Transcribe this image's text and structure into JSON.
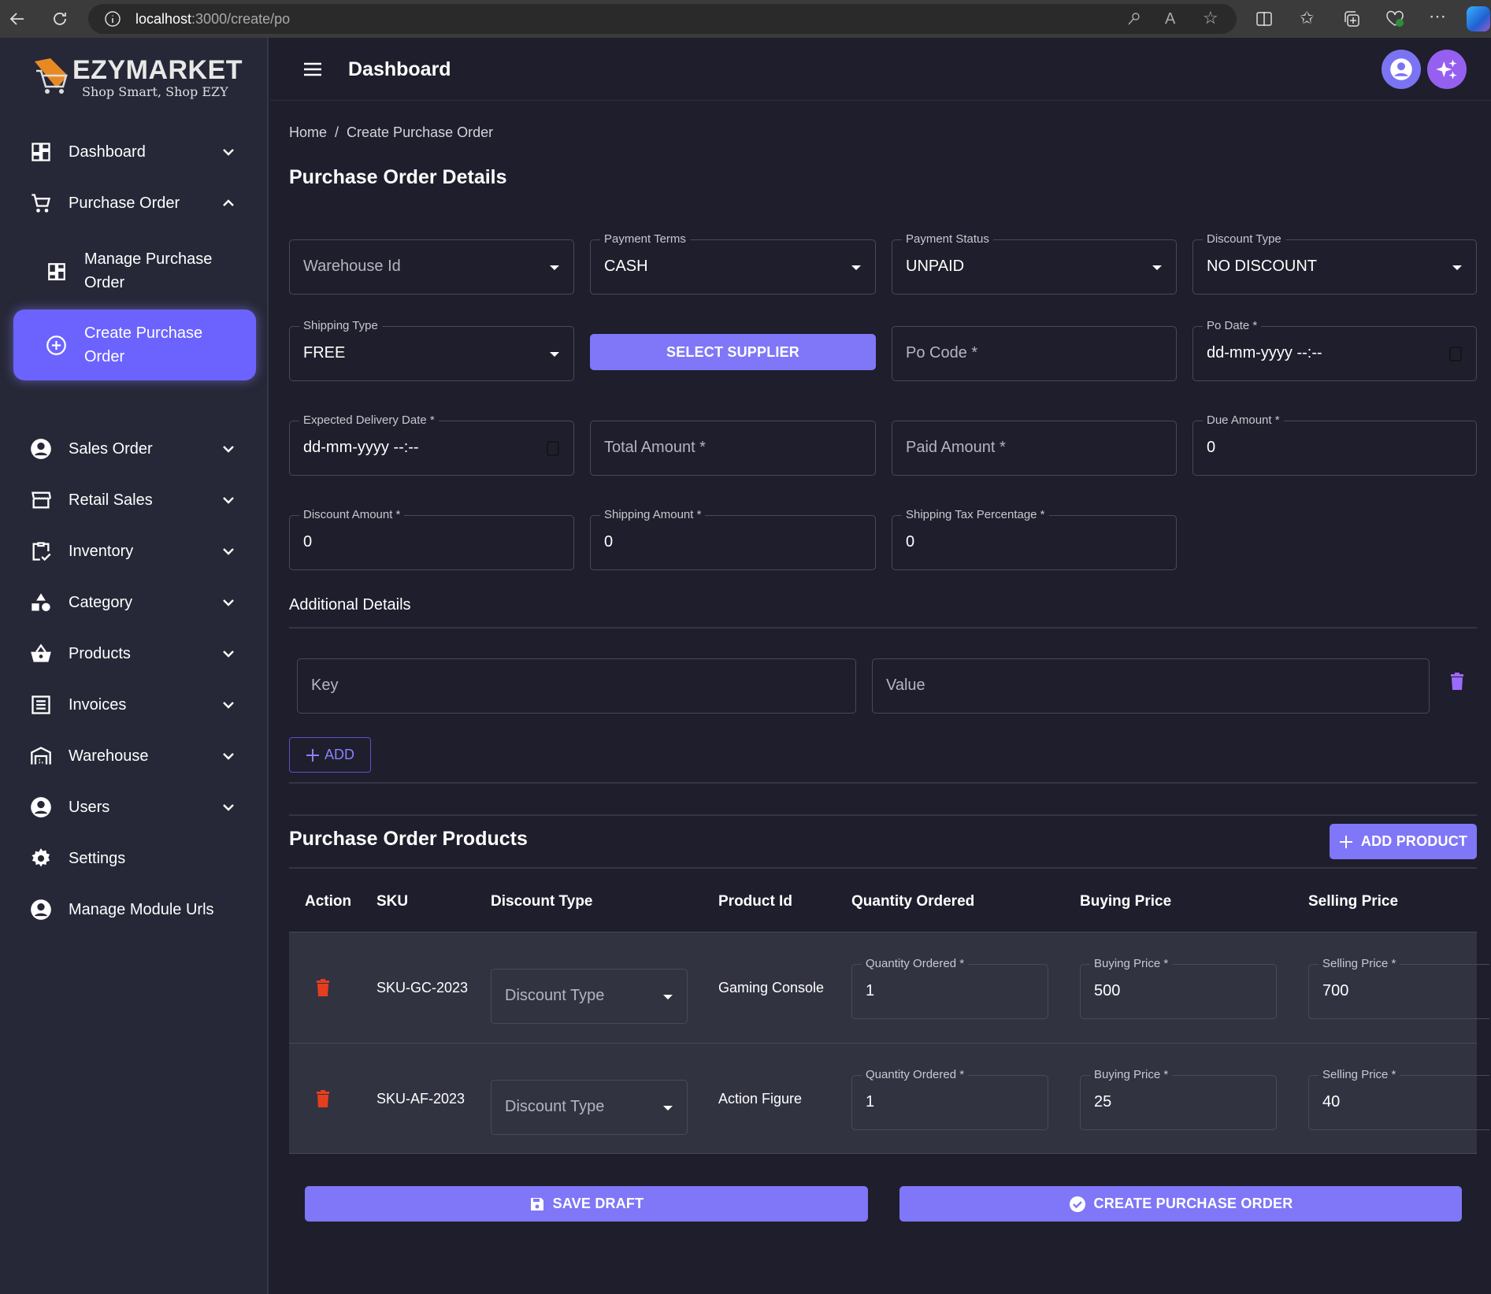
{
  "browser": {
    "url_host": "localhost",
    "url_path": ":3000/create/po"
  },
  "brand": {
    "name": "EZYMARKET",
    "tagline": "Shop Smart, Shop EZY"
  },
  "header": {
    "title": "Dashboard"
  },
  "sidebar": {
    "items": [
      {
        "label": "Dashboard",
        "icon": "dashboard-icon",
        "chevron": "down"
      },
      {
        "label": "Purchase Order",
        "icon": "cart-icon",
        "chevron": "up"
      },
      {
        "label": "Sales Order",
        "icon": "account-circle-icon",
        "chevron": "down"
      },
      {
        "label": "Retail Sales",
        "icon": "storefront-icon",
        "chevron": "down"
      },
      {
        "label": "Inventory",
        "icon": "clipboard-check-icon",
        "chevron": "down"
      },
      {
        "label": "Category",
        "icon": "category-shapes-icon",
        "chevron": "down"
      },
      {
        "label": "Products",
        "icon": "basket-icon",
        "chevron": "down"
      },
      {
        "label": "Invoices",
        "icon": "receipt-icon",
        "chevron": "down"
      },
      {
        "label": "Warehouse",
        "icon": "warehouse-icon",
        "chevron": "down"
      },
      {
        "label": "Users",
        "icon": "account-circle-icon",
        "chevron": "down"
      },
      {
        "label": "Settings",
        "icon": "gear-icon"
      },
      {
        "label": "Manage Module Urls",
        "icon": "account-circle-icon"
      }
    ],
    "sub_items": [
      {
        "label_line1": "Manage Purchase",
        "label_line2": "Order",
        "icon": "dashboard-icon"
      },
      {
        "label_line1": "Create Purchase",
        "label_line2": "Order",
        "icon": "add-circle-icon",
        "active": true
      }
    ]
  },
  "breadcrumb": {
    "home": "Home",
    "separator": "/",
    "current": "Create Purchase Order"
  },
  "details": {
    "title": "Purchase Order Details",
    "warehouse_id": {
      "placeholder": "Warehouse Id"
    },
    "payment_terms": {
      "label": "Payment Terms",
      "value": "CASH"
    },
    "payment_status": {
      "label": "Payment Status",
      "value": "UNPAID"
    },
    "discount_type": {
      "label": "Discount Type",
      "value": "NO DISCOUNT"
    },
    "shipping_type": {
      "label": "Shipping Type",
      "value": "FREE"
    },
    "select_supplier": "SELECT SUPPLIER",
    "po_code": {
      "placeholder": "Po Code *"
    },
    "po_date": {
      "label": "Po Date *",
      "value": "dd-mm-yyyy --:--"
    },
    "expected_delivery_date": {
      "label": "Expected Delivery Date *",
      "value": "dd-mm-yyyy --:--"
    },
    "total_amount": {
      "placeholder": "Total Amount *"
    },
    "paid_amount": {
      "placeholder": "Paid Amount *"
    },
    "due_amount": {
      "label": "Due Amount *",
      "value": "0"
    },
    "discount_amount": {
      "label": "Discount Amount *",
      "value": "0"
    },
    "shipping_amount": {
      "label": "Shipping Amount *",
      "value": "0"
    },
    "shipping_tax_percentage": {
      "label": "Shipping Tax Percentage *",
      "value": "0"
    }
  },
  "additional": {
    "title": "Additional Details",
    "key_placeholder": "Key",
    "value_placeholder": "Value",
    "add_label": "ADD"
  },
  "products": {
    "title": "Purchase Order Products",
    "add_product_label": "ADD PRODUCT",
    "columns": [
      "Action",
      "SKU",
      "Discount Type",
      "Product Id",
      "Quantity Ordered",
      "Buying Price",
      "Selling Price"
    ],
    "rows": [
      {
        "sku": "SKU-GC-2023",
        "discount_type_placeholder": "Discount Type",
        "product_id": "Gaming Console",
        "quantity_label": "Quantity Ordered *",
        "quantity": "1",
        "buying_label": "Buying Price *",
        "buying_price": "500",
        "selling_label": "Selling Price *",
        "selling_price": "700"
      },
      {
        "sku": "SKU-AF-2023",
        "discount_type_placeholder": "Discount Type",
        "product_id": "Action Figure",
        "quantity_label": "Quantity Ordered *",
        "quantity": "1",
        "buying_label": "Buying Price *",
        "buying_price": "25",
        "selling_label": "Selling Price *",
        "selling_price": "40"
      }
    ]
  },
  "actions": {
    "save_draft": "SAVE DRAFT",
    "create_po": "CREATE PURCHASE ORDER"
  },
  "colors": {
    "accent": "#7f77f7",
    "active_nav": "#6c63ff",
    "delete_red": "#e53e1f",
    "delete_purple": "#9b6bff",
    "sidebar_bg": "#262837",
    "main_bg": "#1f1e2c"
  }
}
